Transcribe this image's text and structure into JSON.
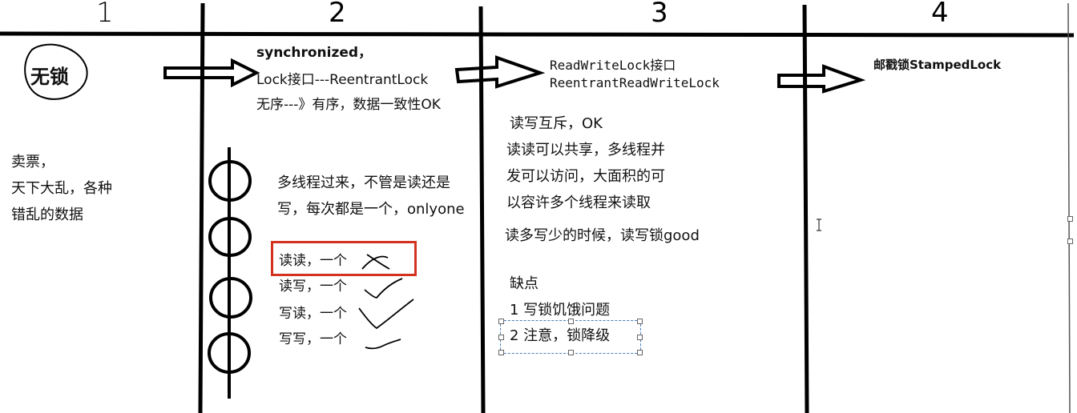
{
  "columns": [
    {
      "number": "1"
    },
    {
      "number": "2"
    },
    {
      "number": "3"
    },
    {
      "number": "4"
    }
  ],
  "col1": {
    "badge": "无锁",
    "lines": [
      "卖票，",
      "天下大乱，各种",
      "错乱的数据"
    ]
  },
  "col2": {
    "header": [
      "synchronized，",
      "Lock接口---ReentrantLock",
      "无序---》有序，数据一致性OK"
    ],
    "desc": [
      "多线程过来，不管是读还是",
      "写，每次都是一个，onlyone"
    ],
    "cases": [
      "读读，一个",
      "读写，一个",
      "写读，一个",
      "写写，一个"
    ]
  },
  "col3": {
    "header": [
      "ReadWriteLock接口",
      "ReentrantReadWriteLock"
    ],
    "body": [
      "读写互斥，OK",
      "读读可以共享，多线程并",
      "发可以访问，大面积的可",
      "以容许多个线程来读取"
    ],
    "summary": "读多写少的时候，读写锁good",
    "cons_title": "缺点",
    "cons": [
      "1 写锁饥饿问题",
      "2 注意，锁降级"
    ]
  },
  "col4": {
    "header": "邮戳锁StampedLock"
  },
  "colors": {
    "red_box": "#d2321e",
    "selection": "#4a7db8",
    "ink": "#000000"
  }
}
